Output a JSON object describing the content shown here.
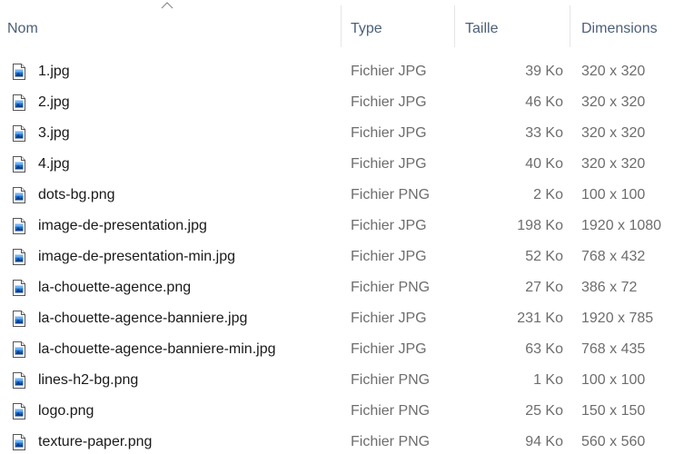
{
  "columns": {
    "name": "Nom",
    "type": "Type",
    "size": "Taille",
    "dimensions": "Dimensions"
  },
  "icons": {
    "sort": "chevron-up-icon",
    "file": "image-file-icon"
  },
  "colors": {
    "header_text": "#4c607a",
    "secondary_text": "#6d6d6d",
    "icon_blue": "#1f6fd1"
  },
  "files": [
    {
      "name": "1.jpg",
      "type": "Fichier JPG",
      "size": "39 Ko",
      "dimensions": "320 x 320"
    },
    {
      "name": "2.jpg",
      "type": "Fichier JPG",
      "size": "46 Ko",
      "dimensions": "320 x 320"
    },
    {
      "name": "3.jpg",
      "type": "Fichier JPG",
      "size": "33 Ko",
      "dimensions": "320 x 320"
    },
    {
      "name": "4.jpg",
      "type": "Fichier JPG",
      "size": "40 Ko",
      "dimensions": "320 x 320"
    },
    {
      "name": "dots-bg.png",
      "type": "Fichier PNG",
      "size": "2 Ko",
      "dimensions": "100 x 100"
    },
    {
      "name": "image-de-presentation.jpg",
      "type": "Fichier JPG",
      "size": "198 Ko",
      "dimensions": "1920 x 1080"
    },
    {
      "name": "image-de-presentation-min.jpg",
      "type": "Fichier JPG",
      "size": "52 Ko",
      "dimensions": "768 x 432"
    },
    {
      "name": "la-chouette-agence.png",
      "type": "Fichier PNG",
      "size": "27 Ko",
      "dimensions": "386 x 72"
    },
    {
      "name": "la-chouette-agence-banniere.jpg",
      "type": "Fichier JPG",
      "size": "231 Ko",
      "dimensions": "1920 x 785"
    },
    {
      "name": "la-chouette-agence-banniere-min.jpg",
      "type": "Fichier JPG",
      "size": "63 Ko",
      "dimensions": "768 x 435"
    },
    {
      "name": "lines-h2-bg.png",
      "type": "Fichier PNG",
      "size": "1 Ko",
      "dimensions": "100 x 100"
    },
    {
      "name": "logo.png",
      "type": "Fichier PNG",
      "size": "25 Ko",
      "dimensions": "150 x 150"
    },
    {
      "name": "texture-paper.png",
      "type": "Fichier PNG",
      "size": "94 Ko",
      "dimensions": "560 x 560"
    }
  ]
}
